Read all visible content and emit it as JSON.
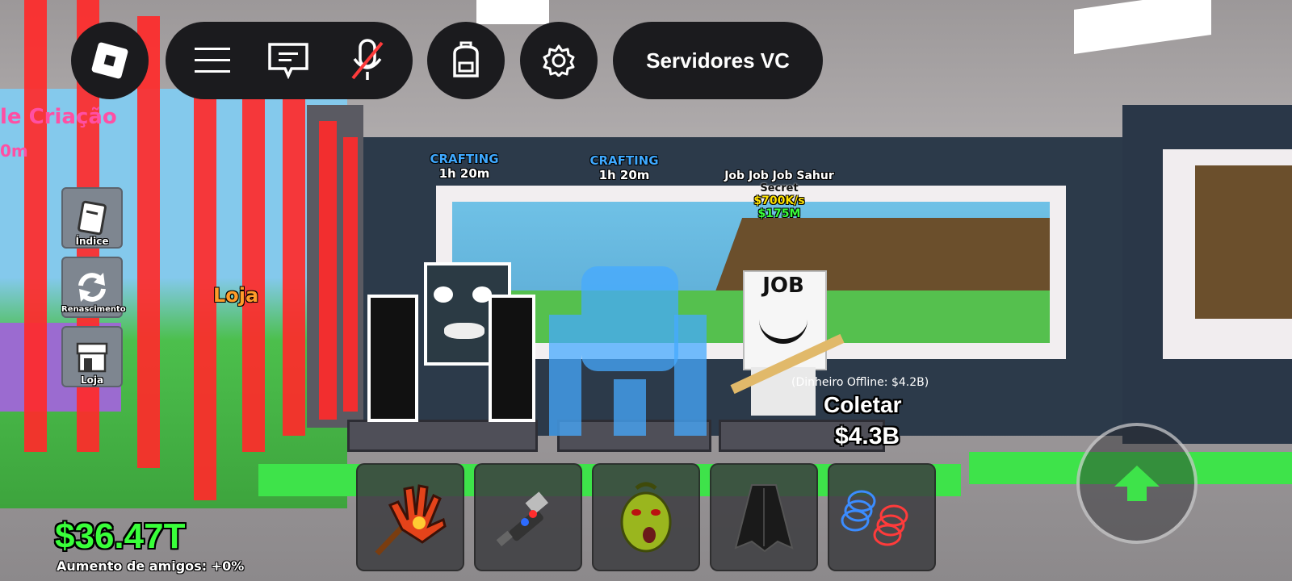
{
  "colors": {
    "accent_green": "#39ff3a",
    "crafting_blue": "#3fa9ff",
    "laser_red": "#ff2a2a",
    "topbar_bg": "#1b1b1e"
  },
  "topbar": {
    "buttons": [
      {
        "icon": "roblox-logo-icon"
      },
      {
        "icon": "hamburger-menu-icon"
      },
      {
        "icon": "chat-icon"
      },
      {
        "icon": "microphone-muted-icon"
      },
      {
        "icon": "backpack-icon"
      },
      {
        "icon": "gear-icon"
      }
    ],
    "voice_servers_label": "Servidores VC"
  },
  "left_world_text": {
    "creation_label": "le Criação",
    "creation_timer": "0m",
    "store_sign": "Loja"
  },
  "side_menu": [
    {
      "label": "Índice",
      "icon": "book-icon"
    },
    {
      "label": "Renascimento",
      "icon": "refresh-icon"
    },
    {
      "label": "Loja",
      "icon": "store-icon"
    }
  ],
  "stands": [
    {
      "status": "CRAFTING",
      "timer": "1h 20m"
    },
    {
      "status": "CRAFTING",
      "timer": "1h 20m"
    },
    {
      "name": "Job Job Job Sahur",
      "rarity": "Secret",
      "rate": "$700K/s",
      "price": "$175M",
      "sign_text": "JOB"
    }
  ],
  "collect": {
    "offline_money": "(Dinheiro Offline: $4.2B)",
    "label": "Coletar",
    "amount": "$4.3B"
  },
  "hotbar": [
    {
      "icon": "fire-glove-icon"
    },
    {
      "icon": "grapple-gun-icon"
    },
    {
      "icon": "green-mask-icon"
    },
    {
      "icon": "black-cape-icon"
    },
    {
      "icon": "speed-coil-icon"
    }
  ],
  "stats": {
    "money": "$36.47T",
    "friend_boost": "Aumento de amigos: +0%"
  },
  "jump_button": {
    "icon": "jump-arrow-icon"
  }
}
